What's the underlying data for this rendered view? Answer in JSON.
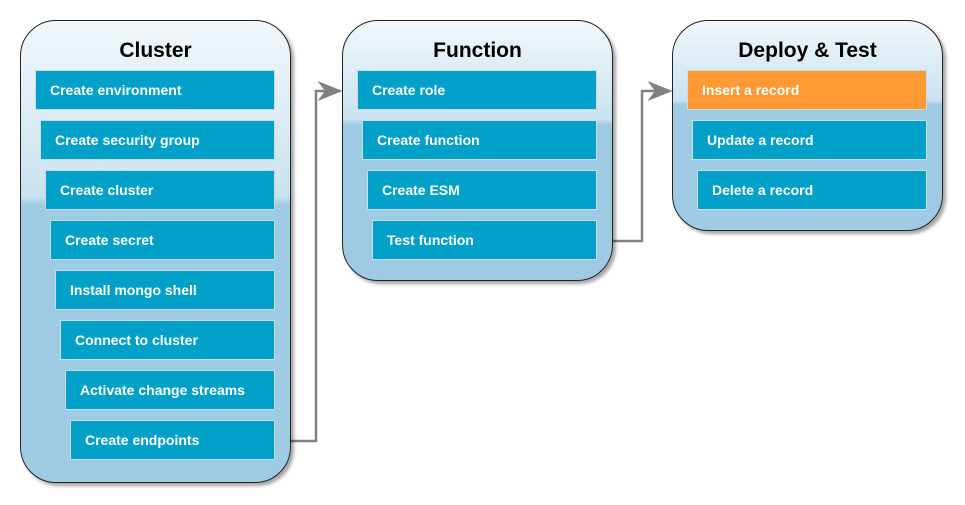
{
  "groups": [
    {
      "title": "Cluster",
      "steps": [
        "Create environment",
        "Create security group",
        "Create cluster",
        "Create secret",
        "Install mongo shell",
        "Connect to cluster",
        "Activate change streams",
        "Create endpoints"
      ]
    },
    {
      "title": "Function",
      "steps": [
        "Create role",
        "Create function",
        "Create ESM",
        "Test function"
      ]
    },
    {
      "title": "Deploy & Test",
      "steps": [
        "Insert a record",
        "Update a record",
        "Delete a record"
      ]
    }
  ],
  "active_step": "Insert a record",
  "colors": {
    "step": "#00a0c8",
    "active_step": "#ff9933",
    "group_fill": "#9ecbe3",
    "arrow": "#808080"
  }
}
